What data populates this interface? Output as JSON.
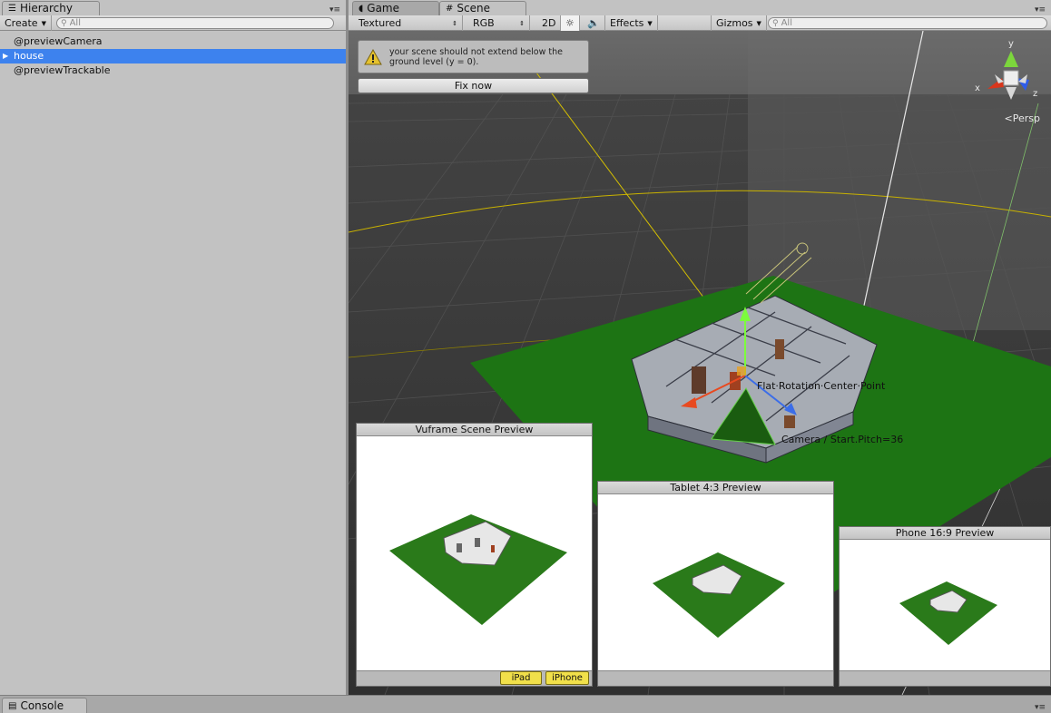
{
  "hierarchy": {
    "tab_label": "Hierarchy",
    "create_label": "Create",
    "search_placeholder": "All",
    "items": [
      {
        "label": "@previewCamera"
      },
      {
        "label": "house"
      },
      {
        "label": "@previewTrackable"
      }
    ]
  },
  "scene": {
    "tabs": [
      {
        "label": "Game"
      },
      {
        "label": "Scene"
      }
    ],
    "toolbar": {
      "draw_mode": "Textured",
      "render_mode": "RGB",
      "mode_2d": "2D",
      "effects_label": "Effects",
      "gizmos_label": "Gizmos",
      "search_placeholder": "All"
    },
    "warning": {
      "text": "your scene should not extend below the ground level (y = 0).",
      "fix_button": "Fix now"
    },
    "gizmo_axes": {
      "x": "x",
      "y": "y",
      "z": "z"
    },
    "projection_label": "Persp",
    "labels": {
      "point_label": "Flat·Rotation·Center·Point",
      "camera_label": "Camera / Start.Pitch=36"
    },
    "previews": [
      {
        "title": "Vuframe Scene Preview",
        "buttons": [
          "iPad",
          "iPhone"
        ]
      },
      {
        "title": "Tablet 4:3 Preview"
      },
      {
        "title": "Phone 16:9 Preview"
      }
    ]
  },
  "console": {
    "tab_label": "Console"
  },
  "colors": {
    "selection": "#3d82ee",
    "ground_green": "#1f7a14",
    "button_yellow": "#f1e04a"
  }
}
